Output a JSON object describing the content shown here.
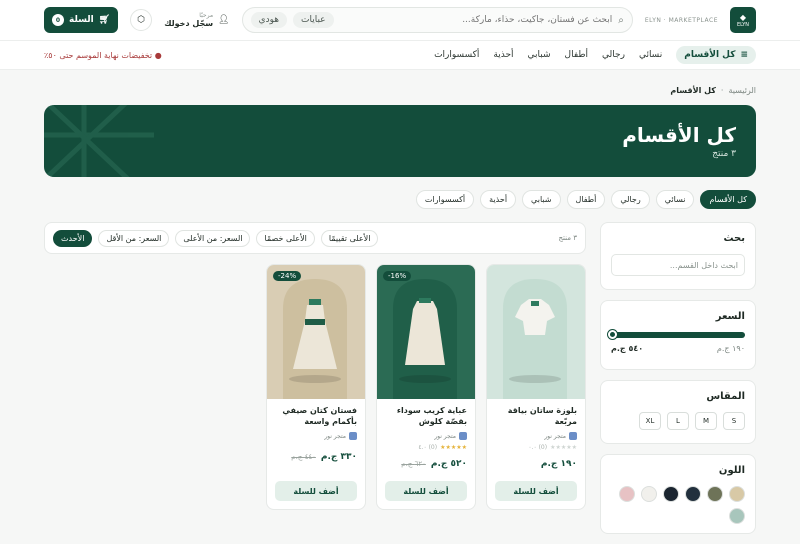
{
  "header": {
    "logo_mark": "◆",
    "logo_text": "ELYN",
    "brand_sub": "ELYN · MARKETPLACE",
    "search_placeholder": "ابحث عن فستان، جاكيت، حذاء، ماركة...",
    "search_chips": [
      "عبايات",
      "هودي"
    ],
    "account_small": "مرحبًا",
    "account_big": "سجّل دخولك",
    "cart_label": "السلة",
    "cart_count": "0"
  },
  "nav": {
    "all_label": "كل الأقسام",
    "links": [
      "نسائي",
      "رجالي",
      "أطفال",
      "شبابي",
      "أحذية",
      "أكسسوارات"
    ],
    "promo": "● تخفيضات نهاية الموسم حتى ٥٠٪"
  },
  "breadcrumb": {
    "home": "الرئيسية",
    "sep": "·",
    "current": "كل الأقسام"
  },
  "hero": {
    "title": "كل الأقسام",
    "count": "٣ منتج"
  },
  "categories": [
    {
      "label": "كل الأقسام",
      "active": true
    },
    {
      "label": "نسائي"
    },
    {
      "label": "رجالي"
    },
    {
      "label": "أطفال"
    },
    {
      "label": "شبابي"
    },
    {
      "label": "أحذية"
    },
    {
      "label": "أكسسوارات"
    }
  ],
  "sort": {
    "options": [
      "الأحدث",
      "السعر: من الأقل",
      "السعر: من الأعلى",
      "الأعلى خصمًا",
      "الأعلى تقييمًا"
    ],
    "active": 0,
    "total": "٣ منتج"
  },
  "filters": {
    "search_title": "بحث",
    "search_placeholder": "ابحث داخل القسم...",
    "price_title": "السعر",
    "price_min": "١٩٠ ج.م",
    "price_max": "٥٤٠ ج.م",
    "price_fraction_min": 0.0,
    "price_fraction_max": 1.0,
    "size_title": "المقاس",
    "sizes": [
      "S",
      "M",
      "L",
      "XL"
    ],
    "color_title": "اللون",
    "colors": [
      "#d8c9a6",
      "#6e7358",
      "#22303d",
      "#1b2530",
      "#f1f0ec",
      "#e7c2c4",
      "#a8c6bc"
    ]
  },
  "products": [
    {
      "name": "بلوزة ساتان بياقة مربّعة",
      "vendor": "متجر نور",
      "rating": "(0) ٠.٠",
      "stars": "★★★★★",
      "stars_empty": true,
      "price": "١٩٠ ج.م",
      "old_price": "",
      "discount": "",
      "add_label": "أضف للسلة",
      "bg": "#d3e5dd"
    },
    {
      "name": "عباية كريب سوداء بقصّة كلوش",
      "vendor": "متجر نور",
      "rating": "(0) ٤.٠",
      "stars": "★★★★★",
      "stars_empty": false,
      "price": "٥٢٠ ج.م",
      "old_price": "٦٢٠ ج.م",
      "discount": "16%-",
      "add_label": "أضف للسلة",
      "bg": "#2b6b54"
    },
    {
      "name": "فستان كتان صيفي بأكمام واسعة",
      "vendor": "متجر نور",
      "rating": "",
      "stars": "",
      "stars_empty": false,
      "price": "٣٣٠ ج.م",
      "old_price": "٤٤٠ ج.م",
      "discount": "24%-",
      "add_label": "أضف للسلة",
      "bg": "#d9cdb4"
    }
  ]
}
